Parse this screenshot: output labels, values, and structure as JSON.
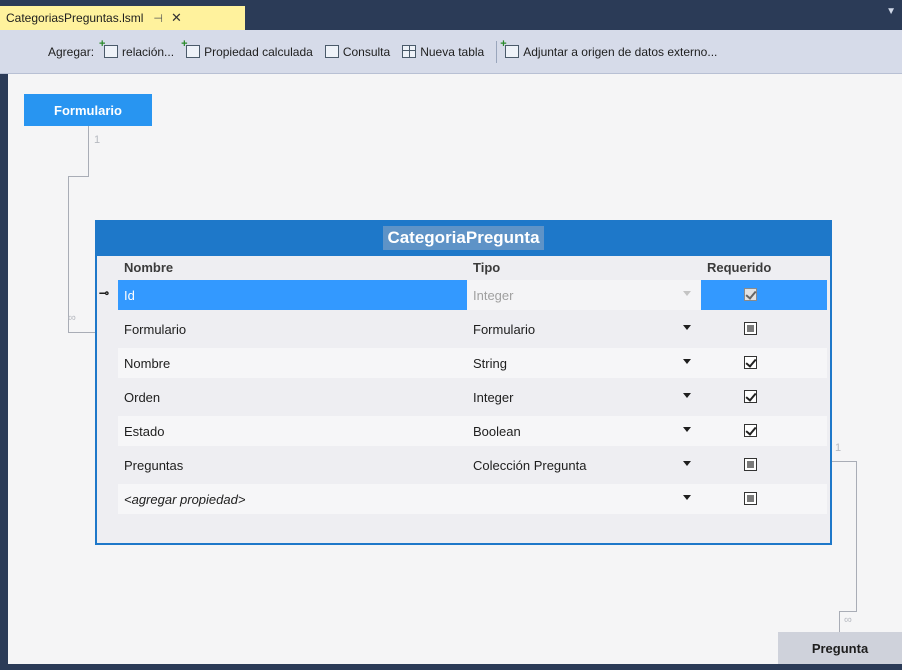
{
  "tab": {
    "title": "CategoriasPreguntas.lsml",
    "pin": "⊣",
    "close": "✕"
  },
  "toolbar": {
    "add_label": "Agregar:",
    "items": [
      {
        "label": "relación...",
        "icon": "relation-icon"
      },
      {
        "label": "Propiedad calculada",
        "icon": "computed-property-icon"
      },
      {
        "label": "Consulta",
        "icon": "query-icon"
      },
      {
        "label": "Nueva tabla",
        "icon": "table-icon"
      },
      {
        "label": "Adjuntar a origen de datos externo...",
        "icon": "attach-datasource-icon"
      }
    ]
  },
  "entities": {
    "formulario": "Formulario",
    "pregunta": "Pregunta"
  },
  "multiplicity": {
    "top_one": "1",
    "top_many": "∞",
    "right_one": "1",
    "right_many": "∞"
  },
  "table": {
    "title": "CategoriaPregunta",
    "columns": {
      "name": "Nombre",
      "type": "Tipo",
      "required": "Requerido"
    },
    "rows": [
      {
        "name": "Id",
        "type": "Integer",
        "required": "checked",
        "key": "🔑"
      },
      {
        "name": "Formulario",
        "type": "Formulario",
        "required": "indeterminate"
      },
      {
        "name": "Nombre",
        "type": "String",
        "required": "checked"
      },
      {
        "name": "Orden",
        "type": "Integer",
        "required": "checked"
      },
      {
        "name": "Estado",
        "type": "Boolean",
        "required": "checked"
      },
      {
        "name": "Preguntas",
        "type": "Colección Pregunta",
        "required": "indeterminate"
      },
      {
        "name": "<agregar propiedad>",
        "type": "",
        "required": "indeterminate"
      }
    ]
  },
  "colors": {
    "accent": "#2895f1",
    "selection": "#3399ff",
    "panel": "#1e78c9",
    "chrome": "#2b3b57"
  }
}
